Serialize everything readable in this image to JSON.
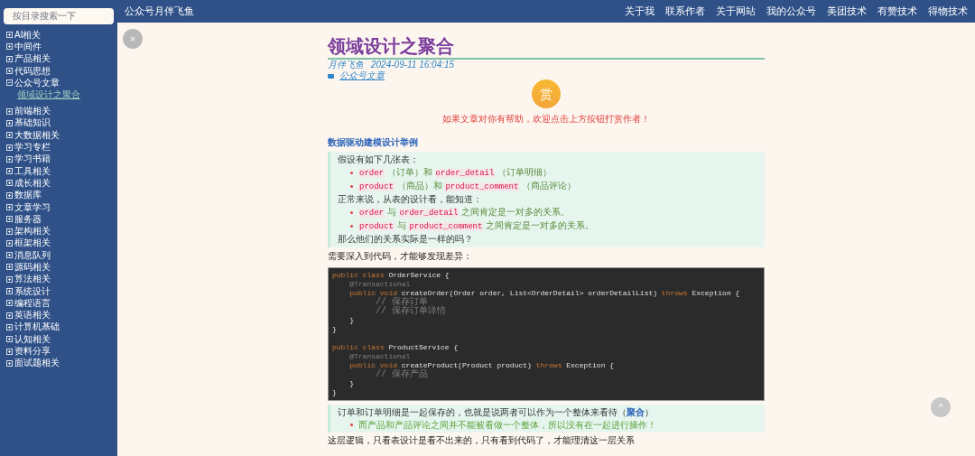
{
  "search": {
    "placeholder": "按目录搜索一下"
  },
  "sidebar": {
    "items": [
      {
        "label": "AI相关",
        "expanded": false
      },
      {
        "label": "中间件",
        "expanded": false
      },
      {
        "label": "产品相关",
        "expanded": false
      },
      {
        "label": "代码思想",
        "expanded": false
      },
      {
        "label": "公众号文章",
        "expanded": true,
        "children": [
          {
            "label": "领域设计之聚合"
          }
        ]
      },
      {
        "label": "前端相关",
        "expanded": false
      },
      {
        "label": "基础知识",
        "expanded": false
      },
      {
        "label": "大数据相关",
        "expanded": false
      },
      {
        "label": "学习专栏",
        "expanded": false
      },
      {
        "label": "学习书籍",
        "expanded": false
      },
      {
        "label": "工具相关",
        "expanded": false
      },
      {
        "label": "成长相关",
        "expanded": false
      },
      {
        "label": "数据库",
        "expanded": false
      },
      {
        "label": "文章学习",
        "expanded": false
      },
      {
        "label": "服务器",
        "expanded": false
      },
      {
        "label": "架构相关",
        "expanded": false
      },
      {
        "label": "框架相关",
        "expanded": false
      },
      {
        "label": "消息队列",
        "expanded": false
      },
      {
        "label": "源码相关",
        "expanded": false
      },
      {
        "label": "算法相关",
        "expanded": false
      },
      {
        "label": "系统设计",
        "expanded": false
      },
      {
        "label": "编程语言",
        "expanded": false
      },
      {
        "label": "英语相关",
        "expanded": false
      },
      {
        "label": "计算机基础",
        "expanded": false
      },
      {
        "label": "认知相关",
        "expanded": false
      },
      {
        "label": "资料分享",
        "expanded": false
      },
      {
        "label": "面试题相关",
        "expanded": false
      }
    ]
  },
  "header": {
    "site_title": "公众号月伴飞鱼",
    "nav": [
      "关于我",
      "联系作者",
      "关于网站",
      "我的公众号",
      "美团技术",
      "有赞技术",
      "得物技术"
    ]
  },
  "close_button": "×",
  "back_to_top": "^",
  "article": {
    "title": "领域设计之聚合",
    "author": "月伴飞鱼",
    "date": "2024-09-11 16:04:15",
    "category": "公众号文章",
    "reward_button": "赏",
    "reward_message": "如果文章对你有帮助，欢迎点击上方按钮打赏作者！",
    "heading": "数据驱动建模设计举例",
    "quote1": [
      {
        "kind": "para",
        "segments": [
          {
            "kind": "text",
            "text": "假设有如下几张表："
          }
        ]
      },
      {
        "kind": "item",
        "segments": [
          {
            "kind": "code",
            "text": "order"
          },
          {
            "kind": "text",
            "text": " （订单）和 "
          },
          {
            "kind": "code",
            "text": "order_detail"
          },
          {
            "kind": "text",
            "text": " （订单明细）"
          }
        ]
      },
      {
        "kind": "item",
        "segments": [
          {
            "kind": "code",
            "text": "product"
          },
          {
            "kind": "text",
            "text": " （商品）和 "
          },
          {
            "kind": "code",
            "text": "product_comment"
          },
          {
            "kind": "text",
            "text": " （商品评论）"
          }
        ]
      },
      {
        "kind": "para",
        "segments": [
          {
            "kind": "text",
            "text": "正常来说，从表的设计看，能知道："
          }
        ]
      },
      {
        "kind": "item",
        "segments": [
          {
            "kind": "code",
            "text": "order"
          },
          {
            "kind": "text",
            "text": " 与 "
          },
          {
            "kind": "code",
            "text": "order_detail"
          },
          {
            "kind": "text",
            "text": " 之间肯定是一对多的关系。"
          }
        ]
      },
      {
        "kind": "item",
        "segments": [
          {
            "kind": "code",
            "text": "product"
          },
          {
            "kind": "text",
            "text": " 与 "
          },
          {
            "kind": "code",
            "text": "product_comment"
          },
          {
            "kind": "text",
            "text": " 之间肯定是一对多的关系。"
          }
        ]
      },
      {
        "kind": "para",
        "segments": [
          {
            "kind": "text",
            "text": "那么他们的关系实际是一样的吗？"
          }
        ]
      }
    ],
    "para1": "需要深入到代码，才能够发现差异：",
    "code": [
      [
        {
          "kind": "keyword",
          "text": "public class "
        },
        {
          "kind": "plain",
          "text": "OrderService {"
        }
      ],
      [
        {
          "kind": "annotation",
          "text": "    @Transactional"
        }
      ],
      [
        {
          "kind": "keyword",
          "text": "    public void "
        },
        {
          "kind": "plain",
          "text": "createOrder(Order order, List<OrderDetail> orderDetailList) "
        },
        {
          "kind": "keyword",
          "text": "throws "
        },
        {
          "kind": "plain",
          "text": "Exception {"
        }
      ],
      [
        {
          "kind": "comment",
          "text": "        // 保存订单"
        }
      ],
      [
        {
          "kind": "comment",
          "text": "        // 保存订单详情"
        }
      ],
      [
        {
          "kind": "plain",
          "text": "    }"
        }
      ],
      [
        {
          "kind": "plain",
          "text": "}"
        }
      ],
      [
        {
          "kind": "blank"
        }
      ],
      [
        {
          "kind": "keyword",
          "text": "public class "
        },
        {
          "kind": "plain",
          "text": "ProductService {"
        }
      ],
      [
        {
          "kind": "annotation",
          "text": "    @Transactional"
        }
      ],
      [
        {
          "kind": "keyword",
          "text": "    public void "
        },
        {
          "kind": "plain",
          "text": "createProduct(Product product) "
        },
        {
          "kind": "keyword",
          "text": "throws "
        },
        {
          "kind": "plain",
          "text": "Exception {"
        }
      ],
      [
        {
          "kind": "comment",
          "text": "        // 保存产品"
        }
      ],
      [
        {
          "kind": "plain",
          "text": "    }"
        }
      ],
      [
        {
          "kind": "plain",
          "text": "}"
        }
      ]
    ],
    "quote2": [
      {
        "kind": "para",
        "segments": [
          {
            "kind": "text",
            "text": "订单和订单明细是一起保存的，也就是说两者可以作为一个整体来看待（"
          },
          {
            "kind": "strong",
            "text": "聚合"
          },
          {
            "kind": "text",
            "text": "）"
          }
        ]
      },
      {
        "kind": "note",
        "segments": [
          {
            "kind": "text",
            "text": "而产品和产品评论之间并不能被看做一个整体，所以没有在一起进行操作！"
          }
        ]
      }
    ],
    "para2": "这层逻辑，只看表设计是看不出来的，只有看到代码了，才能理清这一层关系"
  }
}
